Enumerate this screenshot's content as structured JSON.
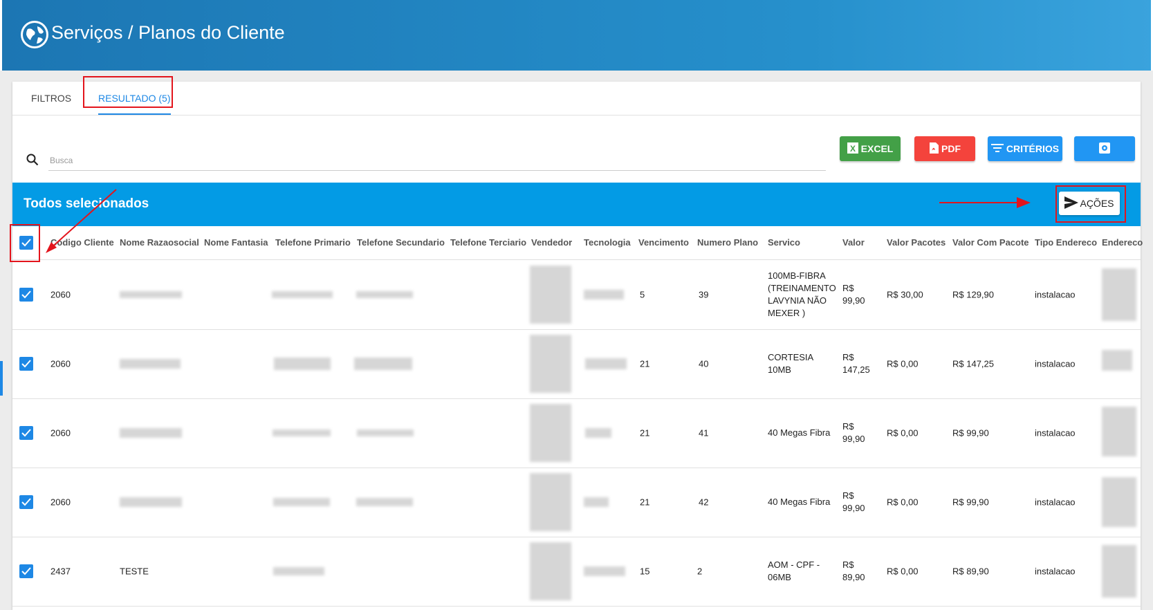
{
  "header": {
    "title": "Serviços / Planos do Cliente",
    "logo_icon": "globe-icon"
  },
  "tabs": [
    {
      "label": "FILTROS"
    },
    {
      "label": "RESULTADO (5)"
    }
  ],
  "search": {
    "placeholder": "Busca"
  },
  "toolbar": {
    "excel_label": "EXCEL",
    "pdf_label": "PDF",
    "criterios_label": "CRITÉRIOS",
    "gear_icon": "gear-icon"
  },
  "selection": {
    "label": "Todos selecionados",
    "acoes_label": "AÇÕES"
  },
  "columns": [
    "Codigo Cliente",
    "Nome Razaosocial",
    "Nome Fantasia",
    "Telefone Primario",
    "Telefone Secundario",
    "Telefone Terciario",
    "Vendedor",
    "Tecnologia",
    "Vencimento",
    "Numero Plano",
    "Servico",
    "Valor",
    "Valor Pacotes",
    "Valor Com Pacote",
    "Tipo Endereco",
    "Endereco"
  ],
  "rows": [
    {
      "codigo": "2060",
      "razao": "",
      "vencimento": "5",
      "numero": "39",
      "servico": "100MB-FIBRA (TREINAMENTO LAVYNIA NÃO MEXER )",
      "valor": "R$ 99,90",
      "pacotes": "R$ 30,00",
      "com_pacote": "R$ 129,90",
      "tipo": "instalacao"
    },
    {
      "codigo": "2060",
      "razao": "",
      "vencimento": "21",
      "numero": "40",
      "servico": "CORTESIA 10MB",
      "valor": "R$ 147,25",
      "pacotes": "R$ 0,00",
      "com_pacote": "R$ 147,25",
      "tipo": "instalacao"
    },
    {
      "codigo": "2060",
      "razao": "",
      "vencimento": "21",
      "numero": "41",
      "servico": "40 Megas Fibra",
      "valor": "R$ 99,90",
      "pacotes": "R$ 0,00",
      "com_pacote": "R$ 99,90",
      "tipo": "instalacao"
    },
    {
      "codigo": "2060",
      "razao": "",
      "vencimento": "21",
      "numero": "42",
      "servico": "40 Megas Fibra",
      "valor": "R$ 99,90",
      "pacotes": "R$ 0,00",
      "com_pacote": "R$ 99,90",
      "tipo": "instalacao"
    },
    {
      "codigo": "2437",
      "razao": "TESTE",
      "vencimento": "15",
      "numero": "2",
      "servico": "AOM - CPF - 06MB",
      "valor": "R$ 89,90",
      "pacotes": "R$ 0,00",
      "com_pacote": "R$ 89,90",
      "tipo": "instalacao"
    }
  ],
  "colors": {
    "header": "#1c76b3",
    "selection_bar": "#039be5",
    "accent": "#1e88e5",
    "excel": "#43a047",
    "pdf": "#f4433c",
    "annotation": "#e3141c"
  }
}
